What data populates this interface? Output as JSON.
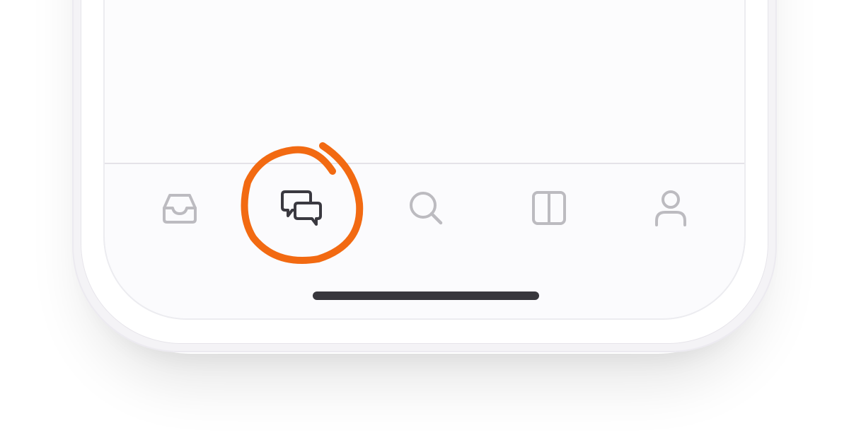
{
  "tab_bar": {
    "tabs": [
      {
        "id": "inbox",
        "icon": "inbox-tray-icon",
        "active": false
      },
      {
        "id": "chats",
        "icon": "chat-bubbles-icon",
        "active": true
      },
      {
        "id": "search",
        "icon": "search-icon",
        "active": false
      },
      {
        "id": "split",
        "icon": "split-view-icon",
        "active": false
      },
      {
        "id": "profile",
        "icon": "person-icon",
        "active": false
      }
    ]
  },
  "colors": {
    "icon_inactive": "#bcbbc0",
    "icon_active": "#3a3940",
    "annotation": "#f26a12",
    "home_indicator": "#38373c"
  }
}
